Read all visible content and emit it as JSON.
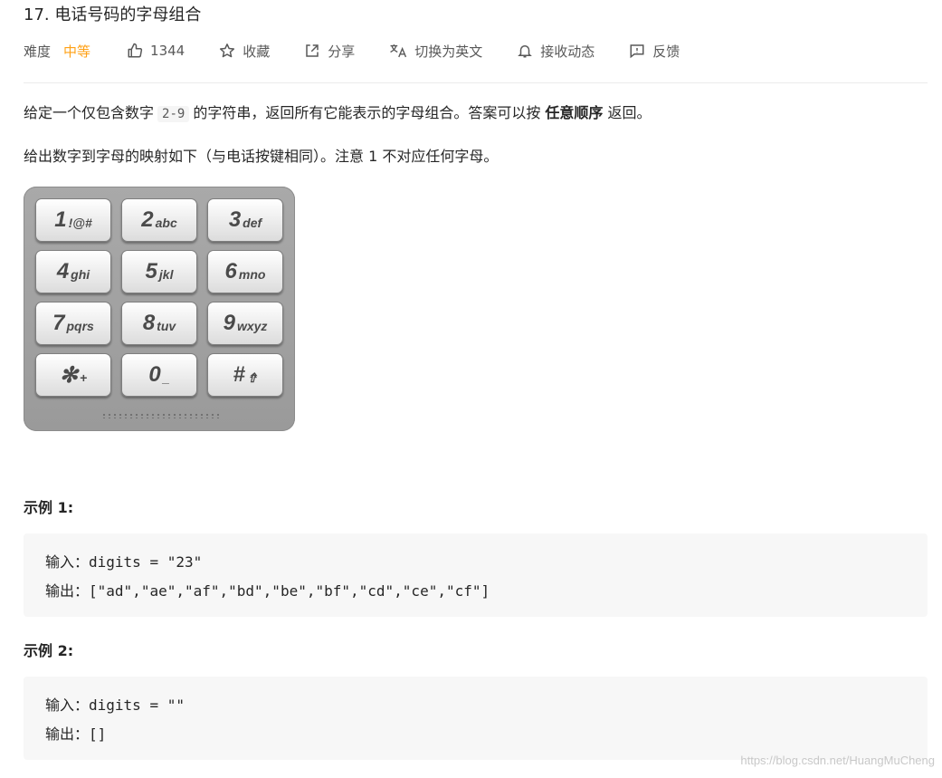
{
  "problem": {
    "title": "17. 电话号码的字母组合",
    "difficulty_label": "难度",
    "difficulty": "中等",
    "likes": "1344",
    "favorite_label": "收藏",
    "share_label": "分享",
    "translate_label": "切换为英文",
    "subscribe_label": "接收动态",
    "feedback_label": "反馈"
  },
  "description": {
    "p1_before": "给定一个仅包含数字",
    "p1_code": "2-9",
    "p1_middle": "的字符串，返回所有它能表示的字母组合。答案可以按",
    "p1_bold": "任意顺序",
    "p1_after": "返回。",
    "p2": "给出数字到字母的映射如下（与电话按键相同）。注意 1 不对应任何字母。"
  },
  "keypad": {
    "keys": [
      {
        "num": "1",
        "letters": "!@#"
      },
      {
        "num": "2",
        "letters": "abc"
      },
      {
        "num": "3",
        "letters": "def"
      },
      {
        "num": "4",
        "letters": "ghi"
      },
      {
        "num": "5",
        "letters": "jkl"
      },
      {
        "num": "6",
        "letters": "mno"
      },
      {
        "num": "7",
        "letters": "pqrs"
      },
      {
        "num": "8",
        "letters": "tuv"
      },
      {
        "num": "9",
        "letters": "wxyz"
      },
      {
        "num": "✻",
        "letters": "+"
      },
      {
        "num": "0",
        "letters": "_"
      },
      {
        "num": "#",
        "letters": "⇮"
      }
    ]
  },
  "examples": [
    {
      "heading": "示例 1:",
      "input_label": "输入：",
      "input": "digits = \"23\"",
      "output_label": "输出：",
      "output": "[\"ad\",\"ae\",\"af\",\"bd\",\"be\",\"bf\",\"cd\",\"ce\",\"cf\"]"
    },
    {
      "heading": "示例 2:",
      "input_label": "输入：",
      "input": "digits = \"\"",
      "output_label": "输出：",
      "output": "[]"
    }
  ],
  "watermark": "https://blog.csdn.net/HuangMuCheng",
  "colors": {
    "difficulty_medium": "#ffa116",
    "text": "#262626",
    "muted": "#595959",
    "code_bg": "#f7f7f7"
  },
  "icons": {
    "like": "thumbs-up-icon",
    "favorite": "star-icon",
    "share": "share-icon",
    "translate": "translate-icon",
    "subscribe": "bell-icon",
    "feedback": "feedback-icon"
  }
}
